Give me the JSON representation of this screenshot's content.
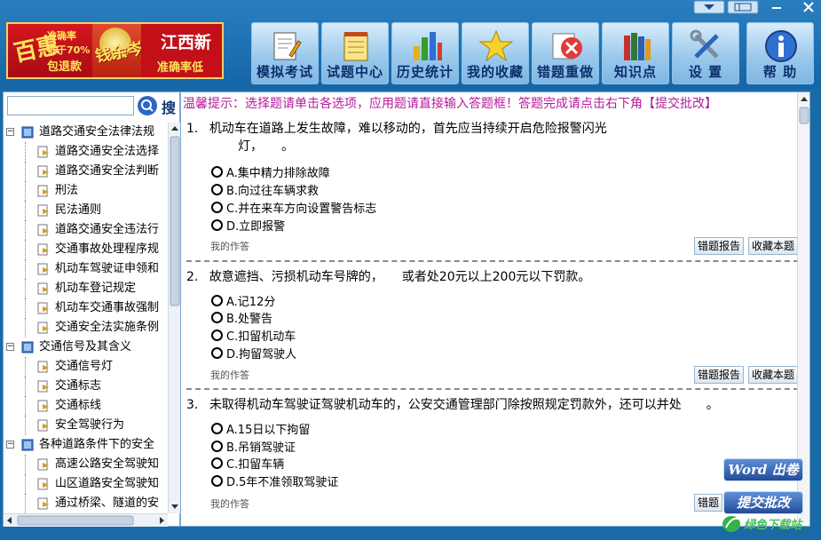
{
  "banner": {
    "seal": "百惠",
    "line1": "准确率",
    "line2": "低于70%",
    "line3": "包退款",
    "brand": "钱余岑",
    "right_title": "江西新",
    "right_sub": "准确率低"
  },
  "toolbar": [
    {
      "label": "模拟考试",
      "icon": "exam-paper-icon"
    },
    {
      "label": "试题中心",
      "icon": "notepad-icon"
    },
    {
      "label": "历史统计",
      "icon": "bar-chart-icon"
    },
    {
      "label": "我的收藏",
      "icon": "star-icon"
    },
    {
      "label": "错题重做",
      "icon": "error-redo-icon"
    },
    {
      "label": "知识点",
      "icon": "books-icon"
    },
    {
      "label": "设 置",
      "icon": "tools-icon"
    },
    {
      "label": "帮 助",
      "icon": "info-icon"
    }
  ],
  "search": {
    "button": "搜",
    "placeholder": ""
  },
  "tree": [
    {
      "label": "道路交通安全法律法规",
      "level": 0,
      "toggle": "−"
    },
    {
      "label": "道路交通安全法选择",
      "level": 1
    },
    {
      "label": "道路交通安全法判断",
      "level": 1
    },
    {
      "label": "刑法",
      "level": 1
    },
    {
      "label": "民法通则",
      "level": 1
    },
    {
      "label": "道路交通安全违法行",
      "level": 1
    },
    {
      "label": "交通事故处理程序规",
      "level": 1
    },
    {
      "label": "机动车驾驶证申领和",
      "level": 1
    },
    {
      "label": "机动车登记规定",
      "level": 1
    },
    {
      "label": "机动车交通事故强制",
      "level": 1
    },
    {
      "label": "交通安全法实施条例",
      "level": 1
    },
    {
      "label": "交通信号及其含义",
      "level": 0,
      "toggle": "−"
    },
    {
      "label": "交通信号灯",
      "level": 1
    },
    {
      "label": "交通标志",
      "level": 1
    },
    {
      "label": "交通标线",
      "level": 1
    },
    {
      "label": "安全驾驶行为",
      "level": 1
    },
    {
      "label": "各种道路条件下的安全",
      "level": 0,
      "toggle": "−"
    },
    {
      "label": "高速公路安全驾驶知",
      "level": 1
    },
    {
      "label": "山区道路安全驾驶知",
      "level": 1
    },
    {
      "label": "通过桥梁、隧道的安",
      "level": 1
    }
  ],
  "tip": "温馨提示：选择题请单击各选项，应用题请直接输入答题框！答题完成请点击右下角【提交批改】",
  "questions": [
    {
      "num": "1.",
      "text_line1": "机动车在道路上发生故障，难以移动的，首先应当持续开启危险报警闪光",
      "text_line2": "灯，　　。",
      "options": [
        "A.集中精力排除故障",
        "B.向过往车辆求救",
        "C.并在来车方向设置警告标志",
        "D.立即报警"
      ]
    },
    {
      "num": "2.",
      "text_line1": "故意遮挡、污损机动车号牌的，　　或者处20元以上200元以下罚款。",
      "text_line2": "",
      "options": [
        "A.记12分",
        "B.处警告",
        "C.扣留机动车",
        "D.拘留驾驶人"
      ]
    },
    {
      "num": "3.",
      "text_line1": "未取得机动车驾驶证驾驶机动车的，公安交通管理部门除按照规定罚款外，还可以并处　　。",
      "text_line2": "",
      "options": [
        "A.15日以下拘留",
        "B.吊销驾驶证",
        "C.扣留车辆",
        "D.5年不准领取驾驶证"
      ]
    }
  ],
  "labels": {
    "my_answer": "我的作答",
    "report_error": "错题报告",
    "favorite": "收藏本题",
    "report_error_cut": "错题"
  },
  "float_buttons": {
    "word_export": "Word 出卷",
    "submit": "提交批改"
  },
  "watermark": "绿色下载站",
  "colors": {
    "tip": "#b51a9a",
    "frame": "#1a6aa8",
    "button_text": "#0c2f6b"
  }
}
